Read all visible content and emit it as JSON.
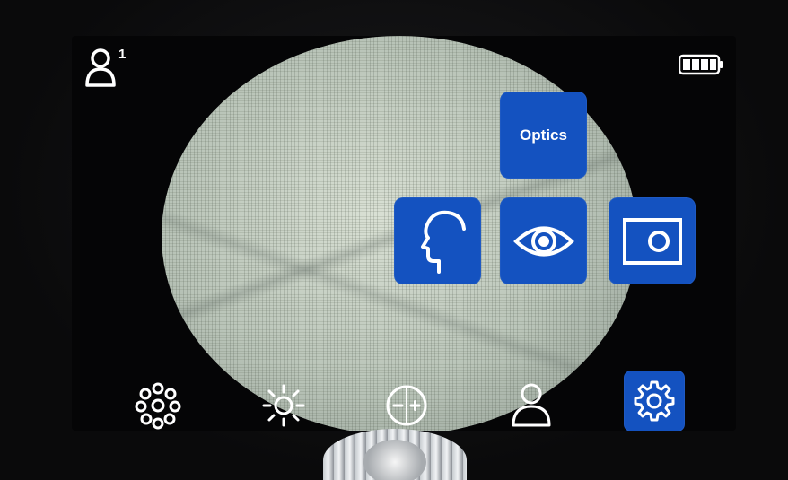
{
  "profile": {
    "user_number": "1",
    "icon": "user-icon"
  },
  "battery": {
    "icon": "battery-icon",
    "level_fraction": 1.0
  },
  "menu": {
    "optics_label": "Optics",
    "tiles": [
      {
        "name": "head-profile-tile",
        "icon": "head-profile-icon"
      },
      {
        "name": "eye-tile",
        "icon": "eye-icon"
      },
      {
        "name": "camera-frame-tile",
        "icon": "camera-frame-icon"
      }
    ]
  },
  "bottom_bar": {
    "items": [
      {
        "name": "reticle-dots-button",
        "icon": "dots-cluster-icon"
      },
      {
        "name": "brightness-button",
        "icon": "sun-icon"
      },
      {
        "name": "exposure-button",
        "icon": "plus-minus-icon"
      },
      {
        "name": "user-button",
        "icon": "user-icon"
      },
      {
        "name": "settings-button",
        "icon": "gear-icon",
        "selected": true
      }
    ]
  },
  "colors": {
    "accent": "#1452c0",
    "icon": "#ffffff",
    "background": "#050506"
  }
}
